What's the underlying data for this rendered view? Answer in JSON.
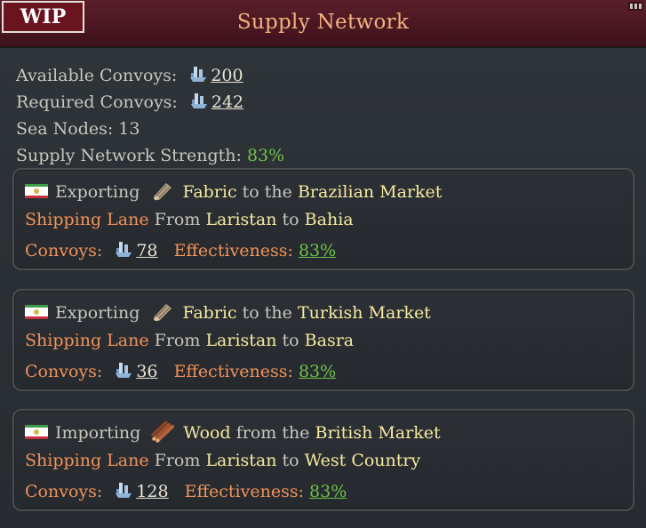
{
  "header": {
    "wip_label": "WIP",
    "title": "Supply Network"
  },
  "stats": {
    "available_label": "Available Convoys:",
    "available_value": "200",
    "required_label": "Required Convoys:",
    "required_value": "242",
    "sea_nodes": "Sea Nodes: 13",
    "strength_label": "Supply Network Strength:",
    "strength_value": "83%"
  },
  "routes": [
    {
      "direction": "Exporting",
      "goods_icon": "fabric-icon",
      "goods": "Fabric",
      "connector": "to the",
      "market": "Brazilian Market",
      "lane_label": "Shipping Lane",
      "from_label": "From",
      "from": "Laristan",
      "to_label": "to",
      "to": "Bahia",
      "convoys_label": "Convoys:",
      "convoys": "78",
      "effectiveness_label": "Effectiveness:",
      "effectiveness": "83%"
    },
    {
      "direction": "Exporting",
      "goods_icon": "fabric-icon",
      "goods": "Fabric",
      "connector": "to the",
      "market": "Turkish Market",
      "lane_label": "Shipping Lane",
      "from_label": "From",
      "from": "Laristan",
      "to_label": "to",
      "to": "Basra",
      "convoys_label": "Convoys:",
      "convoys": "36",
      "effectiveness_label": "Effectiveness:",
      "effectiveness": "83%"
    },
    {
      "direction": "Importing",
      "goods_icon": "wood-icon",
      "goods": "Wood",
      "connector": "from the",
      "market": "British Market",
      "lane_label": "Shipping Lane",
      "from_label": "From",
      "from": "Laristan",
      "to_label": "to",
      "to": "West Country",
      "convoys_label": "Convoys:",
      "convoys": "128",
      "effectiveness_label": "Effectiveness:",
      "effectiveness": "83%"
    }
  ],
  "colors": {
    "title": "#f0b27f",
    "highlight": "#f5eaa1",
    "accent_orange": "#f0935b",
    "positive_green": "#6fc24a",
    "header_bg": "#4a1621"
  }
}
